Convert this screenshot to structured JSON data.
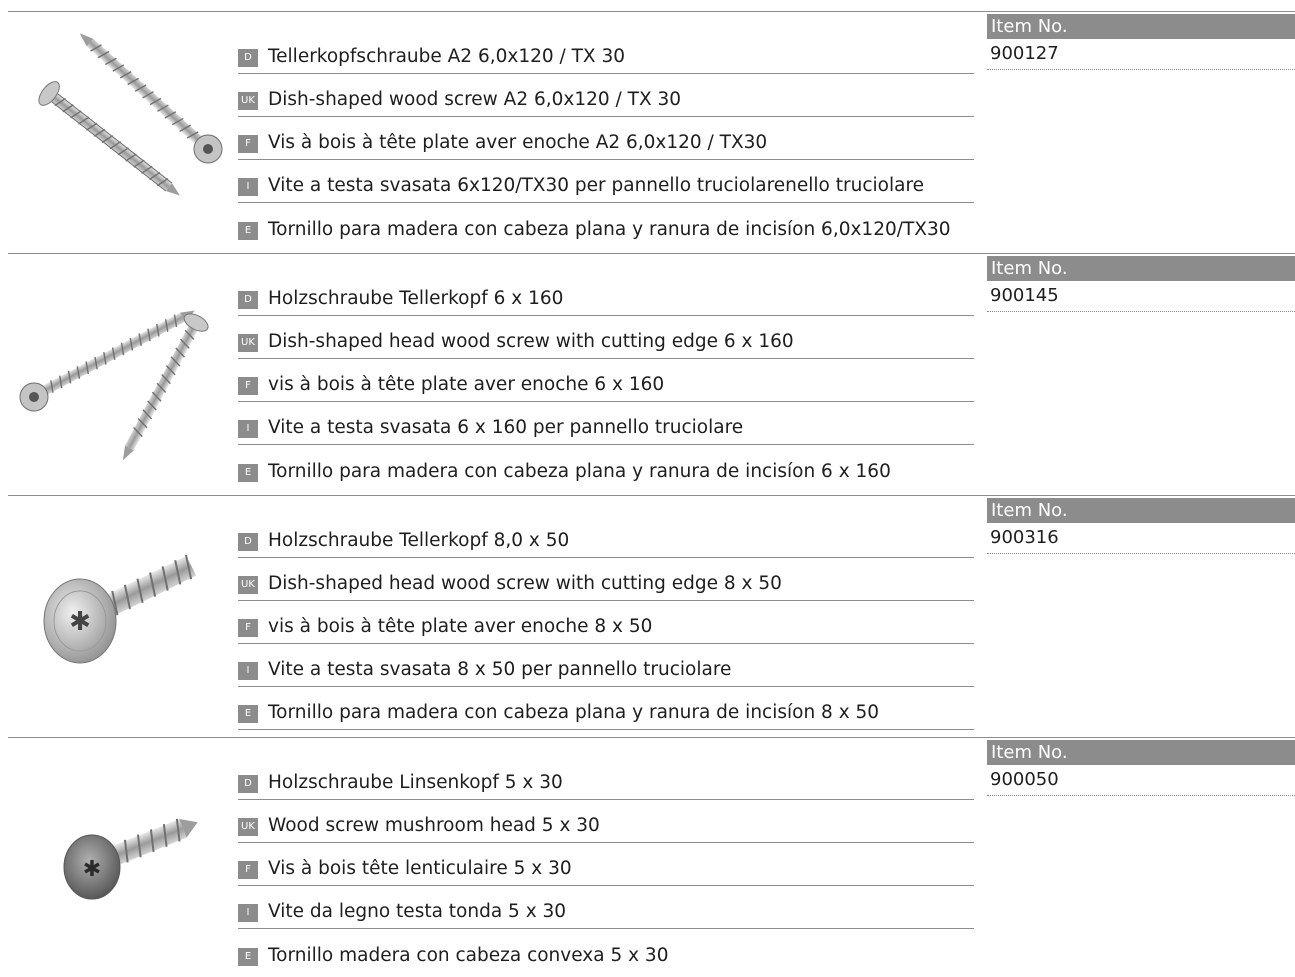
{
  "products": [
    {
      "item_label": "Item No.",
      "item_number": "900127",
      "image_icon": "long-dish-head-screws-pair",
      "descriptions": [
        {
          "lang": "D",
          "text": "Tellerkopfschraube A2 6,0x120 / TX 30"
        },
        {
          "lang": "UK",
          "text": "Dish-shaped wood screw A2 6,0x120 / TX 30"
        },
        {
          "lang": "F",
          "text": "Vis à bois à tête plate aver enoche A2 6,0x120 / TX30"
        },
        {
          "lang": "I",
          "text": "Vite a testa svasata 6x120/TX30 per pannello truciolarenello truciolare"
        },
        {
          "lang": "E",
          "text": "Tornillo para madera con cabeza plana y ranura de incisíon 6,0x120/TX30"
        }
      ]
    },
    {
      "item_label": "Item No.",
      "item_number": "900145",
      "image_icon": "long-dish-head-screws-pair",
      "descriptions": [
        {
          "lang": "D",
          "text": "Holzschraube Tellerkopf 6 x 160"
        },
        {
          "lang": "UK",
          "text": "Dish-shaped head wood screw with cutting edge 6 x 160"
        },
        {
          "lang": "F",
          "text": "vis à bois à tête plate aver enoche 6 x 160"
        },
        {
          "lang": "I",
          "text": "Vite a testa svasata 6 x 160 per pannello truciolare"
        },
        {
          "lang": "E",
          "text": "Tornillo para madera con cabeza plana y ranura de incisíon 6 x 160"
        }
      ]
    },
    {
      "item_label": "Item No.",
      "item_number": "900316",
      "image_icon": "short-dish-head-screw",
      "descriptions": [
        {
          "lang": "D",
          "text": "Holzschraube Tellerkopf 8,0 x 50"
        },
        {
          "lang": "UK",
          "text": "Dish-shaped head wood screw with cutting edge 8 x 50"
        },
        {
          "lang": "F",
          "text": "vis à bois à tête plate aver enoche 8 x 50"
        },
        {
          "lang": "I",
          "text": "Vite a testa svasata 8 x 50 per pannello truciolare"
        },
        {
          "lang": "E",
          "text": "Tornillo para madera con cabeza plana y ranura de incisíon 8 x 50"
        }
      ]
    },
    {
      "item_label": "Item No.",
      "item_number": "900050",
      "image_icon": "mushroom-head-screw",
      "descriptions": [
        {
          "lang": "D",
          "text": "Holzschraube Linsenkopf 5 x 30"
        },
        {
          "lang": "UK",
          "text": "Wood screw mushroom head 5 x 30"
        },
        {
          "lang": "F",
          "text": "Vis à bois tête lenticulaire 5 x 30"
        },
        {
          "lang": "I",
          "text": "Vite da legno testa tonda 5 x 30"
        },
        {
          "lang": "E",
          "text": "Tornillo madera con cabeza convexa 5 x 30"
        }
      ]
    }
  ],
  "colors": {
    "label_bg": "#8c8c8c",
    "rule": "#8c8c8c",
    "text": "#1e1e1e",
    "screw_metal": "#b9b9b9"
  }
}
